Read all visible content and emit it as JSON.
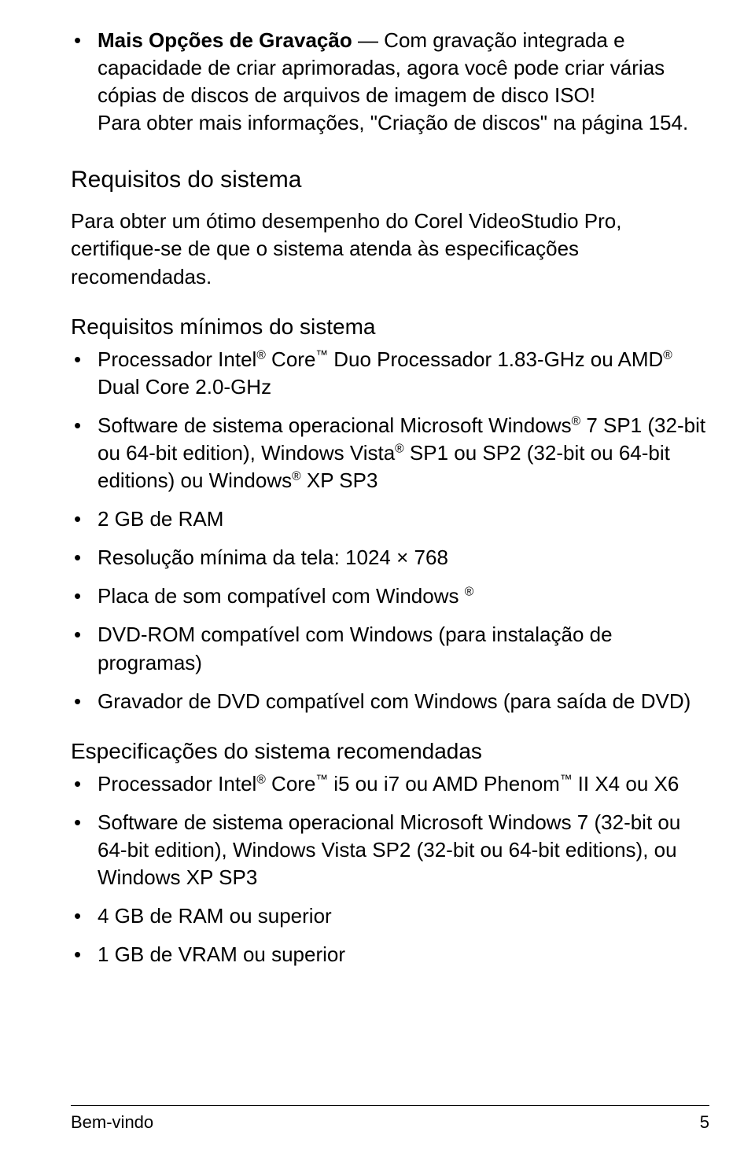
{
  "feature": {
    "title": "Mais Opções de Gravação",
    "rest": " — Com gravação integrada e capacidade de criar aprimoradas, agora você pode criar várias cópias de discos de arquivos de imagem de disco ISO!",
    "sub": "Para obter mais informações, \"Criação de discos\" na página 154."
  },
  "s1": {
    "heading": "Requisitos do sistema",
    "para": "Para obter um ótimo desempenho do Corel VideoStudio Pro, certifique-se de que o sistema atenda às especificações recomendadas."
  },
  "min": {
    "heading": "Requisitos mínimos do sistema",
    "i0a": "Processador Intel",
    "i0b": " Core",
    "i0c": " Duo Processador 1.83-GHz ou AMD",
    "i0d": " Dual Core 2.0-GHz",
    "i1a": "Software de sistema operacional Microsoft Windows",
    "i1b": " 7 SP1 (32-bit ou 64-bit edition), Windows Vista",
    "i1c": " SP1 ou SP2 (32-bit ou 64-bit editions) ou Windows",
    "i1d": " XP SP3",
    "i2": "2 GB de RAM",
    "i3": "Resolução mínima da tela: 1024 × 768",
    "i4a": "Placa de som compatível com Windows ",
    "i5": "DVD-ROM compatível com Windows (para instalação de programas)",
    "i6": "Gravador de DVD compatível com Windows (para saída de DVD)"
  },
  "rec": {
    "heading": "Especificações do sistema recomendadas",
    "i0a": "Processador Intel",
    "i0b": " Core",
    "i0c": " i5 ou i7 ou AMD Phenom",
    "i0d": " II X4 ou X6",
    "i1": "Software de sistema operacional Microsoft Windows 7 (32-bit ou 64-bit edition), Windows Vista SP2 (32-bit ou 64-bit editions), ou Windows XP SP3",
    "i2": "4 GB de RAM ou superior",
    "i3": "1 GB de VRAM ou superior"
  },
  "footer": {
    "section": "Bem-vindo",
    "page": "5"
  },
  "sym": {
    "reg": "®",
    "tm": "™"
  }
}
